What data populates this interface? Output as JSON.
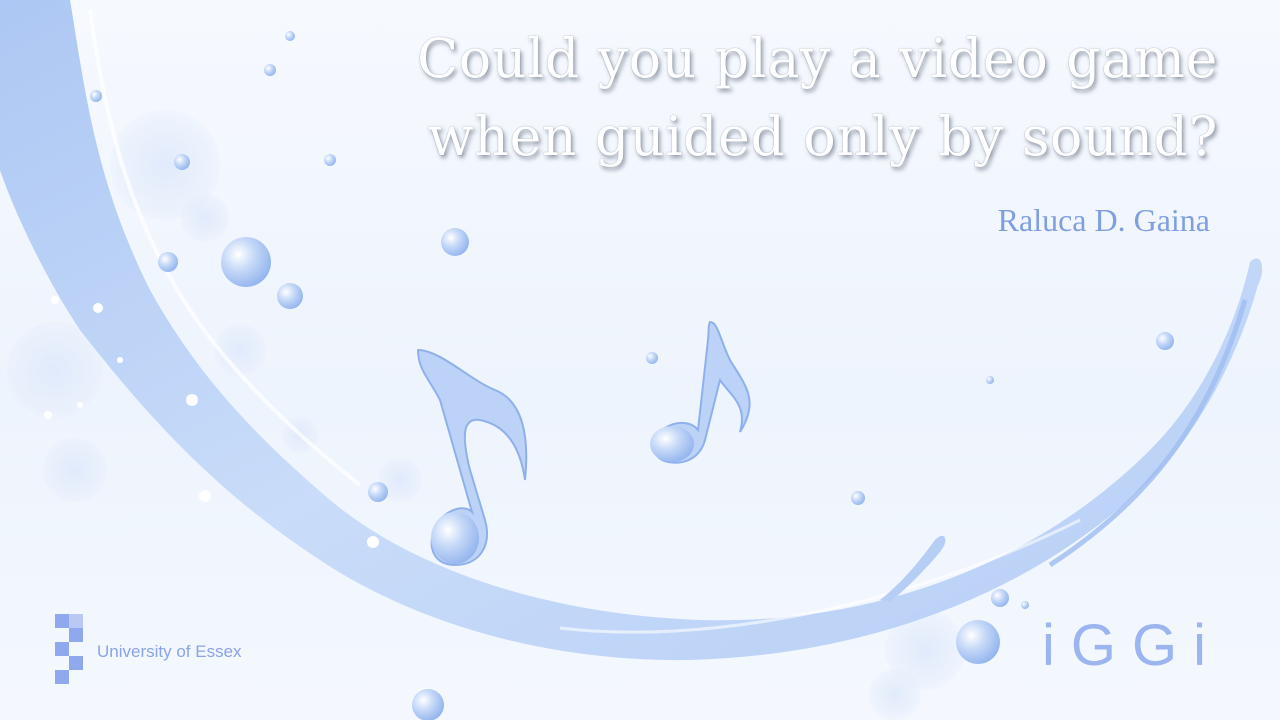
{
  "slide": {
    "title_lines": [
      "Could you play a video game",
      "when guided only by sound?"
    ],
    "author": "Raluca D. Gaina",
    "university": "University of Essex",
    "brand_logo": "iGGi"
  },
  "colors": {
    "splash": "#bcd3f7",
    "accent": "#7f9fe0",
    "logo": "#9cb4f0"
  }
}
